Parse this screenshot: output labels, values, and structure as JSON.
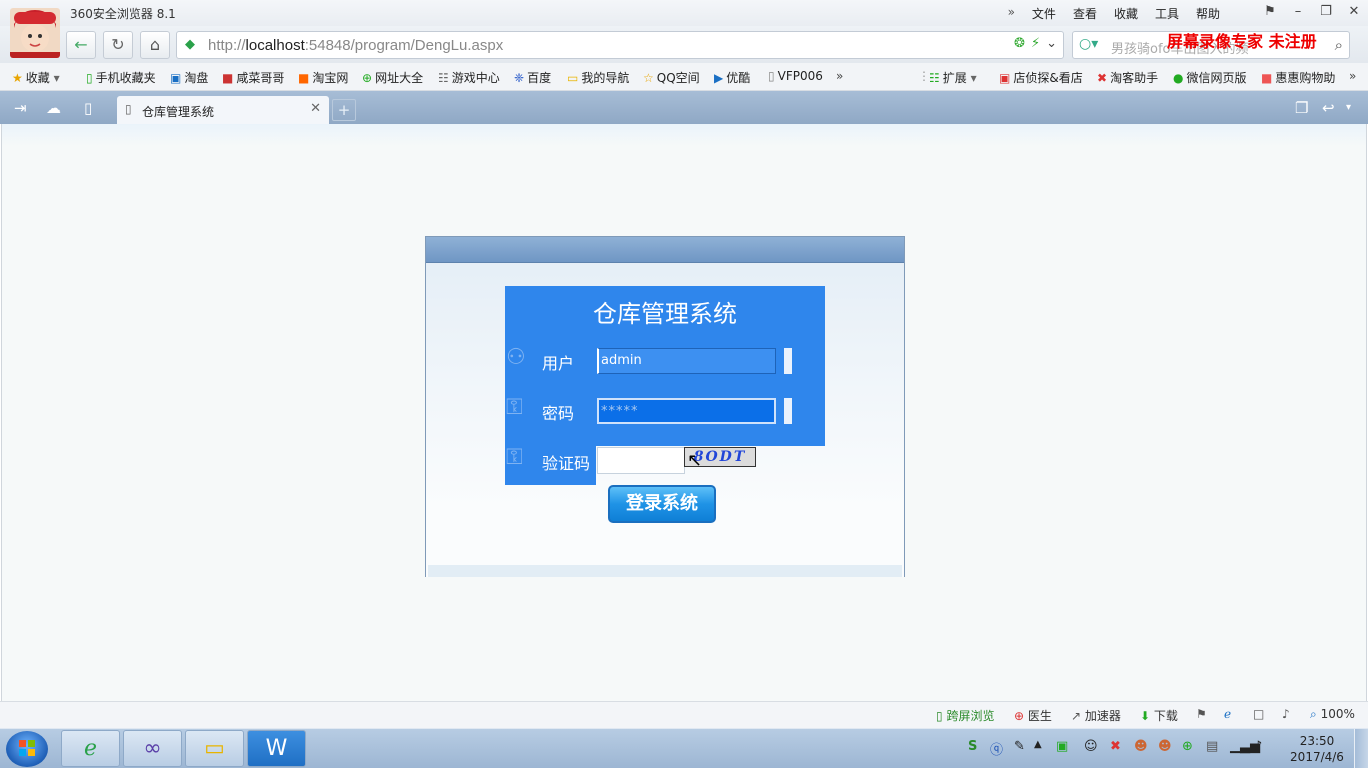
{
  "browser": {
    "title": "360安全浏览器 8.1",
    "menu": [
      "文件",
      "查看",
      "收藏",
      "工具",
      "帮助"
    ],
    "menu_more": "»",
    "url_prefix": "http://",
    "url_host": "localhost",
    "url_rest": ":54848/program/DengLu.aspx",
    "search_placeholder": "男孩骑ofo车出图入的频",
    "watermark": "屏幕录像专家  未注册"
  },
  "favorites": [
    {
      "icon": "star-icon",
      "label": "收藏"
    },
    {
      "icon": "phone-icon",
      "label": "手机收藏夹"
    },
    {
      "icon": "taobao-icon",
      "label": "淘盘"
    },
    {
      "icon": "bi-icon",
      "label": "咸菜哥哥"
    },
    {
      "icon": "tao-icon",
      "label": "淘宝网"
    },
    {
      "icon": "plus-icon",
      "label": "网址大全"
    },
    {
      "icon": "gamepad-icon",
      "label": "游戏中心"
    },
    {
      "icon": "paw-icon",
      "label": "百度"
    },
    {
      "icon": "folder-icon",
      "label": "我的导航"
    },
    {
      "icon": "qzone-icon",
      "label": "QQ空间"
    },
    {
      "icon": "youku-icon",
      "label": "优酷"
    },
    {
      "icon": "page-icon",
      "label": "VFP006"
    }
  ],
  "favorites_right": [
    {
      "icon": "grid-icon",
      "label": "扩展"
    },
    {
      "icon": "shop-icon",
      "label": "店侦探&看店"
    },
    {
      "icon": "cross-icon",
      "label": "淘客助手"
    },
    {
      "icon": "wechat-icon",
      "label": "微信网页版"
    },
    {
      "icon": "hui-icon",
      "label": "惠惠购物助"
    }
  ],
  "tab": {
    "label": "仓库管理系统"
  },
  "login": {
    "title": "仓库管理系统",
    "user_label": "用户",
    "user_value": "admin",
    "password_label": "密码",
    "password_value": "*****",
    "captcha_label": "验证码",
    "captcha_value": "",
    "captcha_image_text": "8ODT",
    "submit": "登录系统"
  },
  "status": {
    "cross_screen": "跨屏浏览",
    "doctor": "医生",
    "accelerator": "加速器",
    "download": "下载",
    "zoom": "100%"
  },
  "taskbar": {
    "time": "23:50",
    "date": "2017/4/6"
  }
}
